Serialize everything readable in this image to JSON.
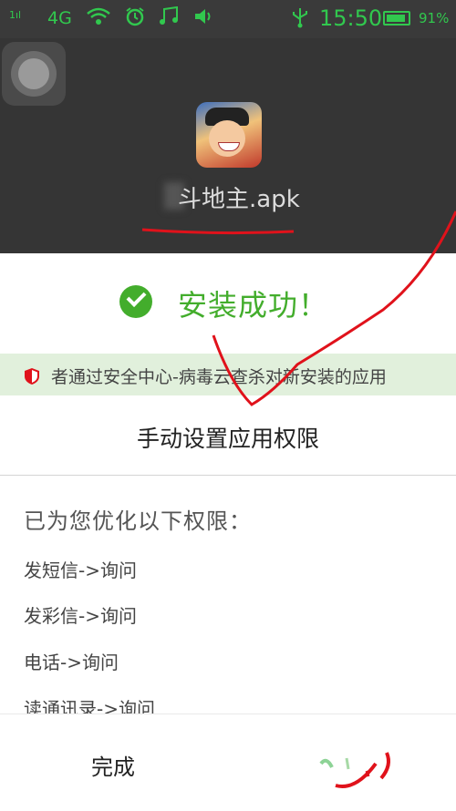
{
  "status_bar": {
    "signal": "1ıl",
    "network": "4G",
    "time": "15:50",
    "battery_pct": "91%",
    "battery_level": 0.91,
    "icons": [
      "signal-icon",
      "wifi-icon",
      "alarm-icon",
      "music-icon",
      "volume-icon",
      "usb-icon",
      "battery-icon"
    ]
  },
  "app": {
    "apk_name": "斗地主.apk"
  },
  "result": {
    "success_text": "安装成功！"
  },
  "banner": {
    "text": "者通过安全中心-病毒云查杀对新安装的应用"
  },
  "actions": {
    "manual_permissions": "手动设置应用权限",
    "done": "完成"
  },
  "permissions": {
    "title": "已为您优化以下权限：",
    "items": [
      "发短信->询问",
      "发彩信->询问",
      "电话->询问",
      "读通讯录->询问"
    ]
  },
  "colors": {
    "accent_green": "#43ad2c",
    "status_green": "#31c84e",
    "banner_bg": "#e1f0dc",
    "header_bg": "#353535",
    "annotation_red": "#e0121b"
  }
}
